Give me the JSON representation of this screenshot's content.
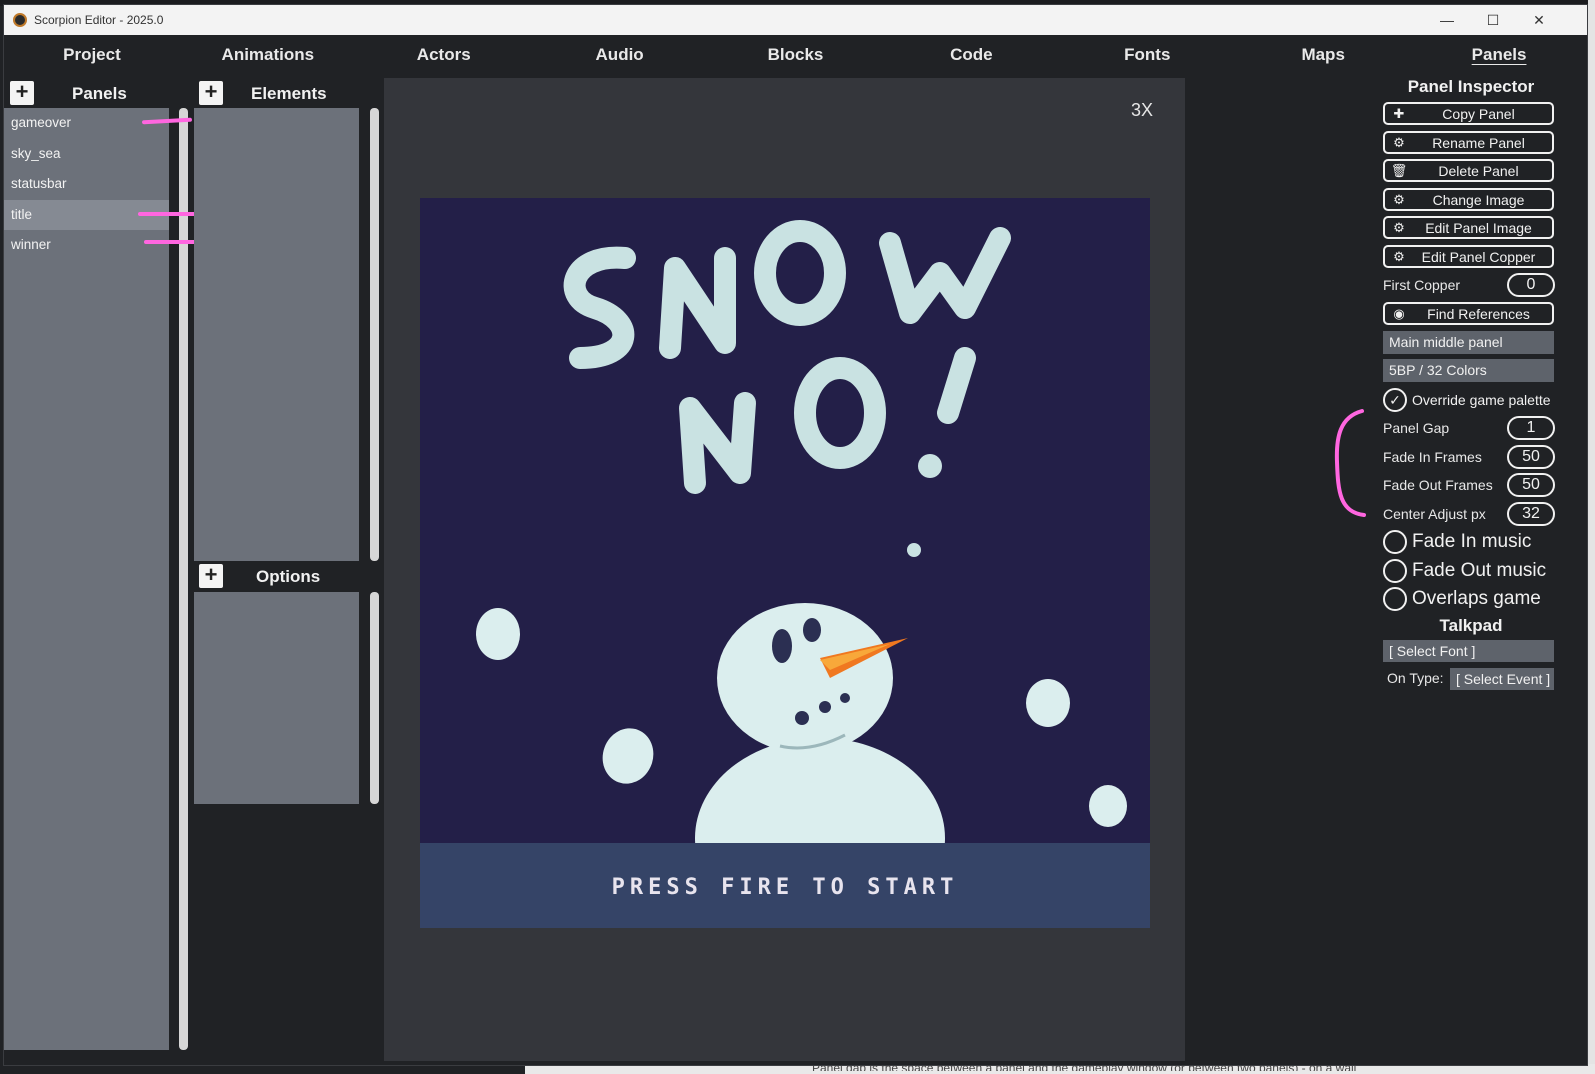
{
  "window": {
    "title": "Scorpion Editor - 2025.0"
  },
  "window_controls": {
    "minimize": "—",
    "maximize": "☐",
    "close": "✕"
  },
  "menu": [
    {
      "label": "Project"
    },
    {
      "label": "Animations"
    },
    {
      "label": "Actors"
    },
    {
      "label": "Audio"
    },
    {
      "label": "Blocks"
    },
    {
      "label": "Code"
    },
    {
      "label": "Fonts"
    },
    {
      "label": "Maps"
    },
    {
      "label": "Panels",
      "active": true
    }
  ],
  "panels_list": {
    "header": "Panels",
    "add_glyph": "+",
    "items": [
      "gameover",
      "sky_sea",
      "statusbar",
      "title",
      "winner"
    ],
    "selected": "title"
  },
  "elements": {
    "header": "Elements",
    "add_glyph": "+"
  },
  "options": {
    "header": "Options",
    "add_glyph": "+"
  },
  "preview": {
    "zoom": "3X",
    "scene_text": "PRESS FIRE TO START",
    "colors": {
      "sky": "#231f48",
      "bar": "#354467",
      "snow": "#dbeeee",
      "carrot": "#f07820"
    }
  },
  "inspector": {
    "title": "Panel Inspector",
    "buttons": [
      {
        "label": "Copy Panel",
        "icon": "plus-icon"
      },
      {
        "label": "Rename Panel",
        "icon": "gear-icon"
      },
      {
        "label": "Delete Panel",
        "icon": "trash-icon"
      },
      {
        "label": "Change Image",
        "icon": "gear-icon"
      },
      {
        "label": "Edit Panel Image",
        "icon": "gear-icon"
      },
      {
        "label": "Edit Panel Copper",
        "icon": "gear-icon"
      }
    ],
    "first_copper": {
      "label": "First Copper",
      "value": "0"
    },
    "find_references": {
      "label": "Find References",
      "icon": "eye-icon"
    },
    "panel_type": "Main middle panel",
    "color_mode": "5BP / 32 Colors",
    "override_palette": {
      "label": "Override game palette",
      "checked": true
    },
    "fields": [
      {
        "label": "Panel Gap",
        "value": "1"
      },
      {
        "label": "Fade In Frames",
        "value": "50"
      },
      {
        "label": "Fade Out Frames",
        "value": "50"
      },
      {
        "label": "Center Adjust px",
        "value": "32"
      }
    ],
    "toggles": [
      {
        "label": "Fade In music",
        "checked": false
      },
      {
        "label": "Fade Out music",
        "checked": false
      },
      {
        "label": "Overlaps game",
        "checked": false
      }
    ],
    "talkpad": "Talkpad",
    "select_font": "[ Select Font ]",
    "on_type_label": "On Type:",
    "select_event": "[ Select Event ]"
  },
  "desktop_text": "Panel gap is the space between a panel and the gameplay window (or between two panels) - on a wall"
}
